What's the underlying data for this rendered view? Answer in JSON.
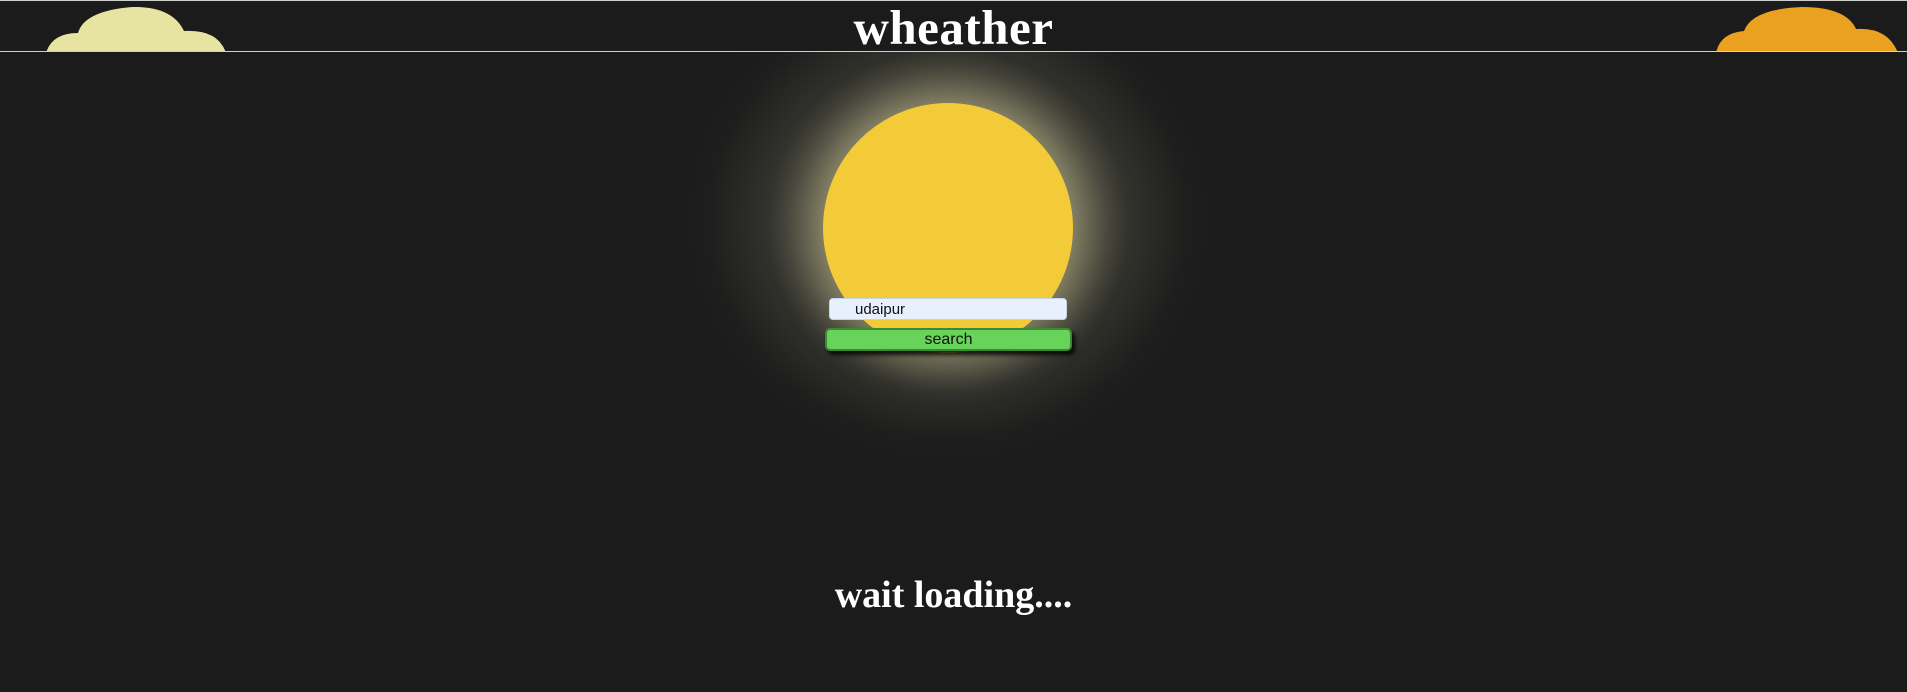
{
  "header": {
    "title": "wheather"
  },
  "search": {
    "value": "udaipur",
    "button_label": "search"
  },
  "status": {
    "text": "wait loading...."
  },
  "colors": {
    "background": "#1b1b1b",
    "sun": "#f3ca38",
    "cloud_left": "#e6e4a0",
    "cloud_right": "#e9a11f",
    "button": "#68d35a",
    "input": "#e8f0fe"
  },
  "icons": {
    "left": "cloud-icon",
    "right": "cloud-icon",
    "center": "sun-icon"
  }
}
